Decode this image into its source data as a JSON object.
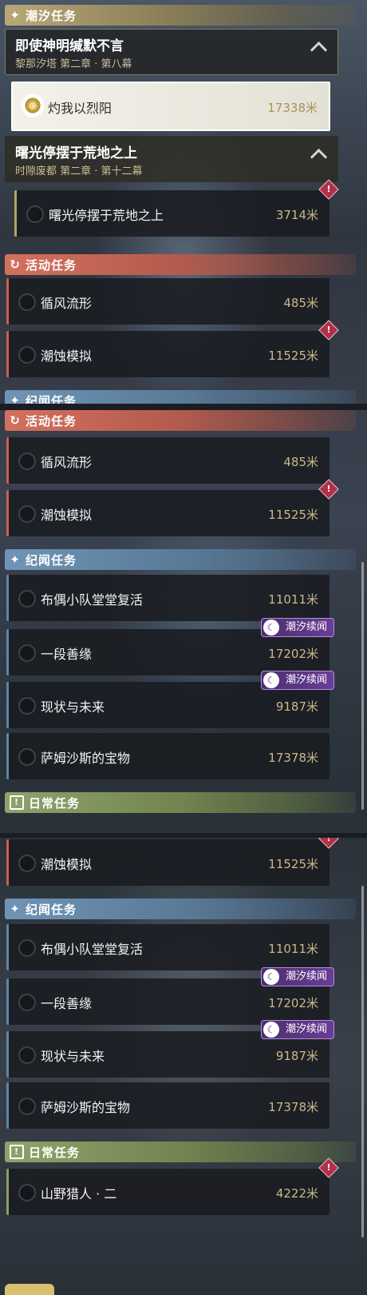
{
  "sections": {
    "tidal": "潮汐任务",
    "event": "活动任务",
    "lore": "纪闻任务",
    "daily": "日常任务"
  },
  "chapters": [
    {
      "title": "即使神明缄默不言",
      "subtitle": "黎那汐塔 第二章 · 第八幕"
    },
    {
      "title": "曙光停摆于荒地之上",
      "subtitle": "时隙废都 第二章 · 第十二幕"
    }
  ],
  "quests": {
    "blazing_sun": {
      "name": "灼我以烈阳",
      "distance": "17338米"
    },
    "dawn": {
      "name": "曙光停摆于荒地之上",
      "distance": "3714米"
    },
    "wind_flow": {
      "name": "循风流形",
      "distance": "485米"
    },
    "erosion_sim": {
      "name": "潮蚀模拟",
      "distance": "11525米"
    },
    "puppet_team": {
      "name": "布偶小队堂堂复活",
      "distance": "11011米"
    },
    "good_bond": {
      "name": "一段善缘",
      "distance": "17202米"
    },
    "present_future": {
      "name": "现状与未来",
      "distance": "9187米"
    },
    "samsas_treasure": {
      "name": "萨姆沙斯的宝物",
      "distance": "17378米"
    },
    "hunter": {
      "name": "山野猎人 · 二",
      "distance": "4222米"
    }
  },
  "badges": {
    "tidal_sequel": "潮汐续闻",
    "alert": "!"
  },
  "colors": {
    "tidal": "#b9a777",
    "event": "#d4705e",
    "lore": "#6f94b5",
    "daily": "#8ea36a",
    "badge": "#6a3d96"
  }
}
